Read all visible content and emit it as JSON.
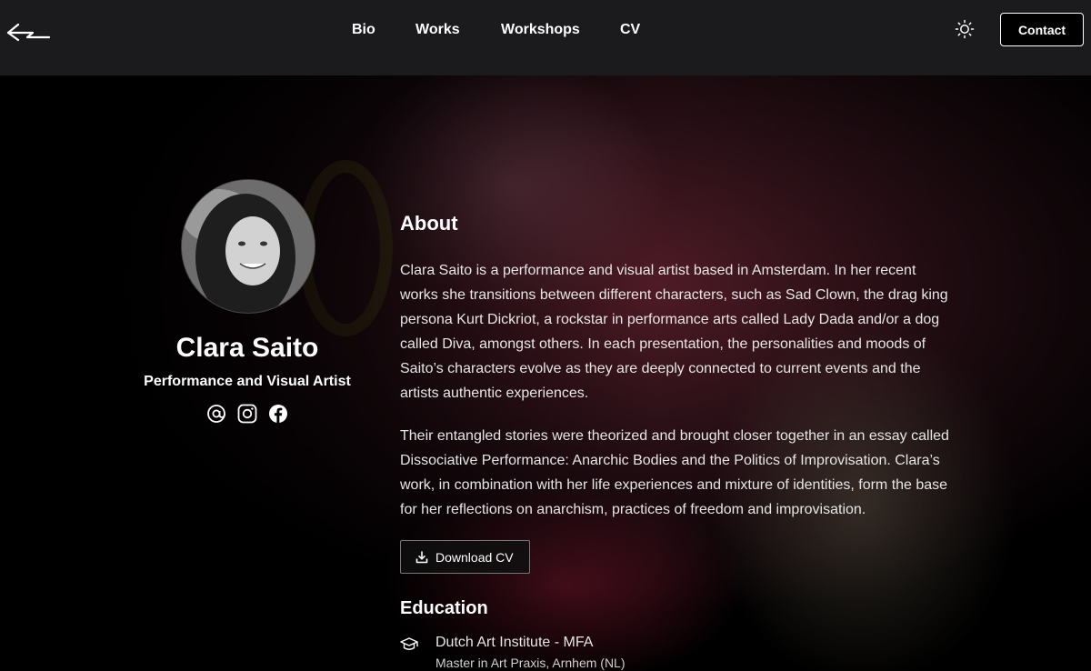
{
  "header": {
    "logo_icon": "back-arrow-logo-icon",
    "nav": [
      {
        "label": "Bio"
      },
      {
        "label": "Works"
      },
      {
        "label": "Workshops"
      },
      {
        "label": "CV"
      }
    ],
    "theme_icon": "sun-icon",
    "contact_label": "Contact"
  },
  "profile": {
    "name": "Clara Saito",
    "role": "Performance and Visual Artist",
    "socials": [
      "email-at-icon",
      "instagram-icon",
      "facebook-icon"
    ]
  },
  "about": {
    "title": "About",
    "lines_1": [
      "Clara Saito is a performance and visual artist based in Amsterdam. In her recent",
      "works she transitions between different characters, such as Sad Clown, the drag king",
      "persona Kurt Dickriot, a rockstar in performance arts called Lady Dada and/or a dog",
      "called Diva, amongst others. In each presentation, the personalities and moods of",
      "Saito’s characters evolve as they are deeply connected to current events and the",
      "artists authentic experiences."
    ],
    "lines_2": [
      "Their entangled stories were theorized and brought closer together in an essay called",
      "Dissociative Performance: Anarchic Bodies and the Politics of Improvisation. Clara’s",
      "work, in combination with her life experiences and mixture of identities, form the base",
      "for her reflections on anarchism, practices of freedom and improvisation."
    ],
    "download_label": "Download CV"
  },
  "education": {
    "title": "Education",
    "items": [
      {
        "title": "Dutch Art Institute - MFA",
        "subtitle": "Master in Art Praxis, Arnhem (NL)"
      }
    ]
  },
  "colors": {
    "header_bg": "#1b1b1d",
    "page_bg": "#000000",
    "text": "#ffffff"
  }
}
